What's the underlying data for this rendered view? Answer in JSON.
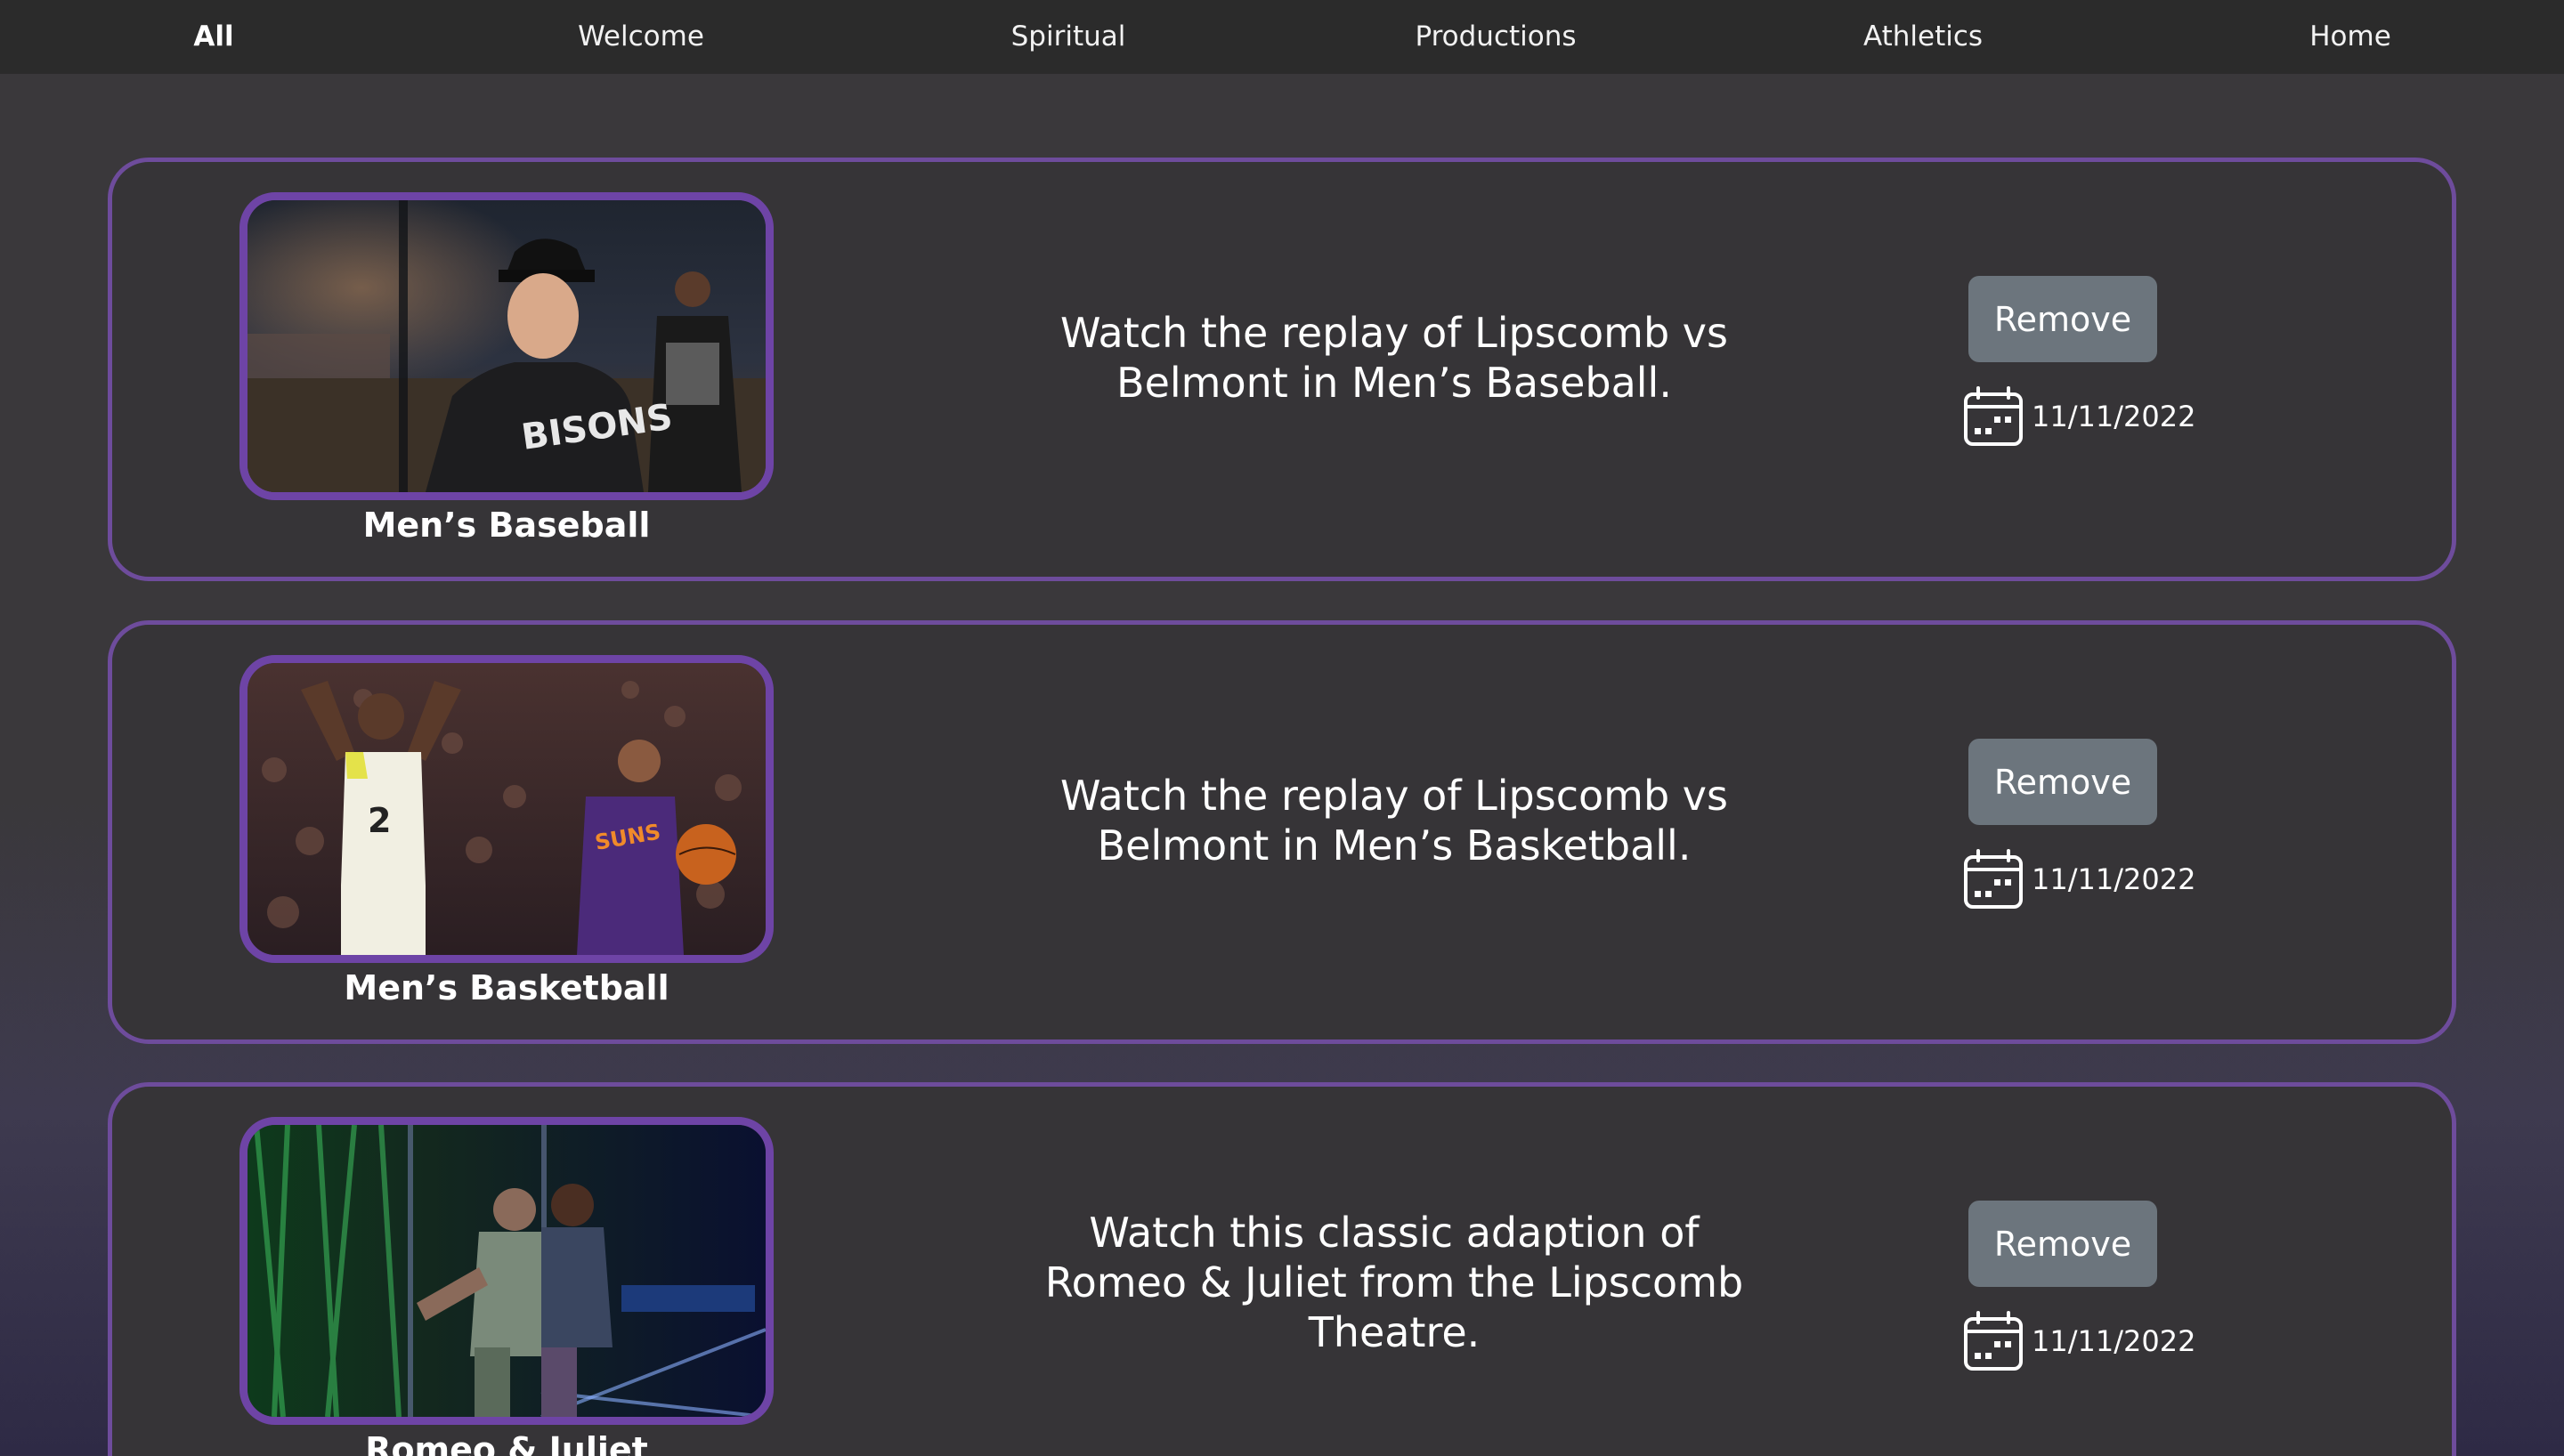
{
  "nav": {
    "items": [
      {
        "label": "All",
        "active": true
      },
      {
        "label": "Welcome",
        "active": false
      },
      {
        "label": "Spiritual",
        "active": false
      },
      {
        "label": "Productions",
        "active": false
      },
      {
        "label": "Athletics",
        "active": false
      },
      {
        "label": "Home",
        "active": false
      }
    ]
  },
  "cards": [
    {
      "title": "Men’s Baseball",
      "description": "Watch the replay of Lipscomb vs Belmont in Men’s Baseball.",
      "button_label": "Remove",
      "date": "11/11/2022",
      "jersey_text": "BISONS"
    },
    {
      "title": "Men’s Basketball",
      "description": "Watch the replay of Lipscomb vs Belmont in Men’s Basketball.",
      "button_label": "Remove",
      "date": "11/11/2022",
      "jersey_text": "SUNS"
    },
    {
      "title": "Romeo & Juliet",
      "description": "Watch this classic adaption of Romeo & Juliet from the Lipscomb Theatre.",
      "button_label": "Remove",
      "date": "11/11/2022"
    }
  ],
  "icons": {
    "date": "calendar-icon"
  },
  "colors": {
    "nav_bg": "#2b2b2b",
    "card_border": "#6e4c9c",
    "thumb_border": "#6e44a6",
    "button_bg": "#6c757d"
  }
}
